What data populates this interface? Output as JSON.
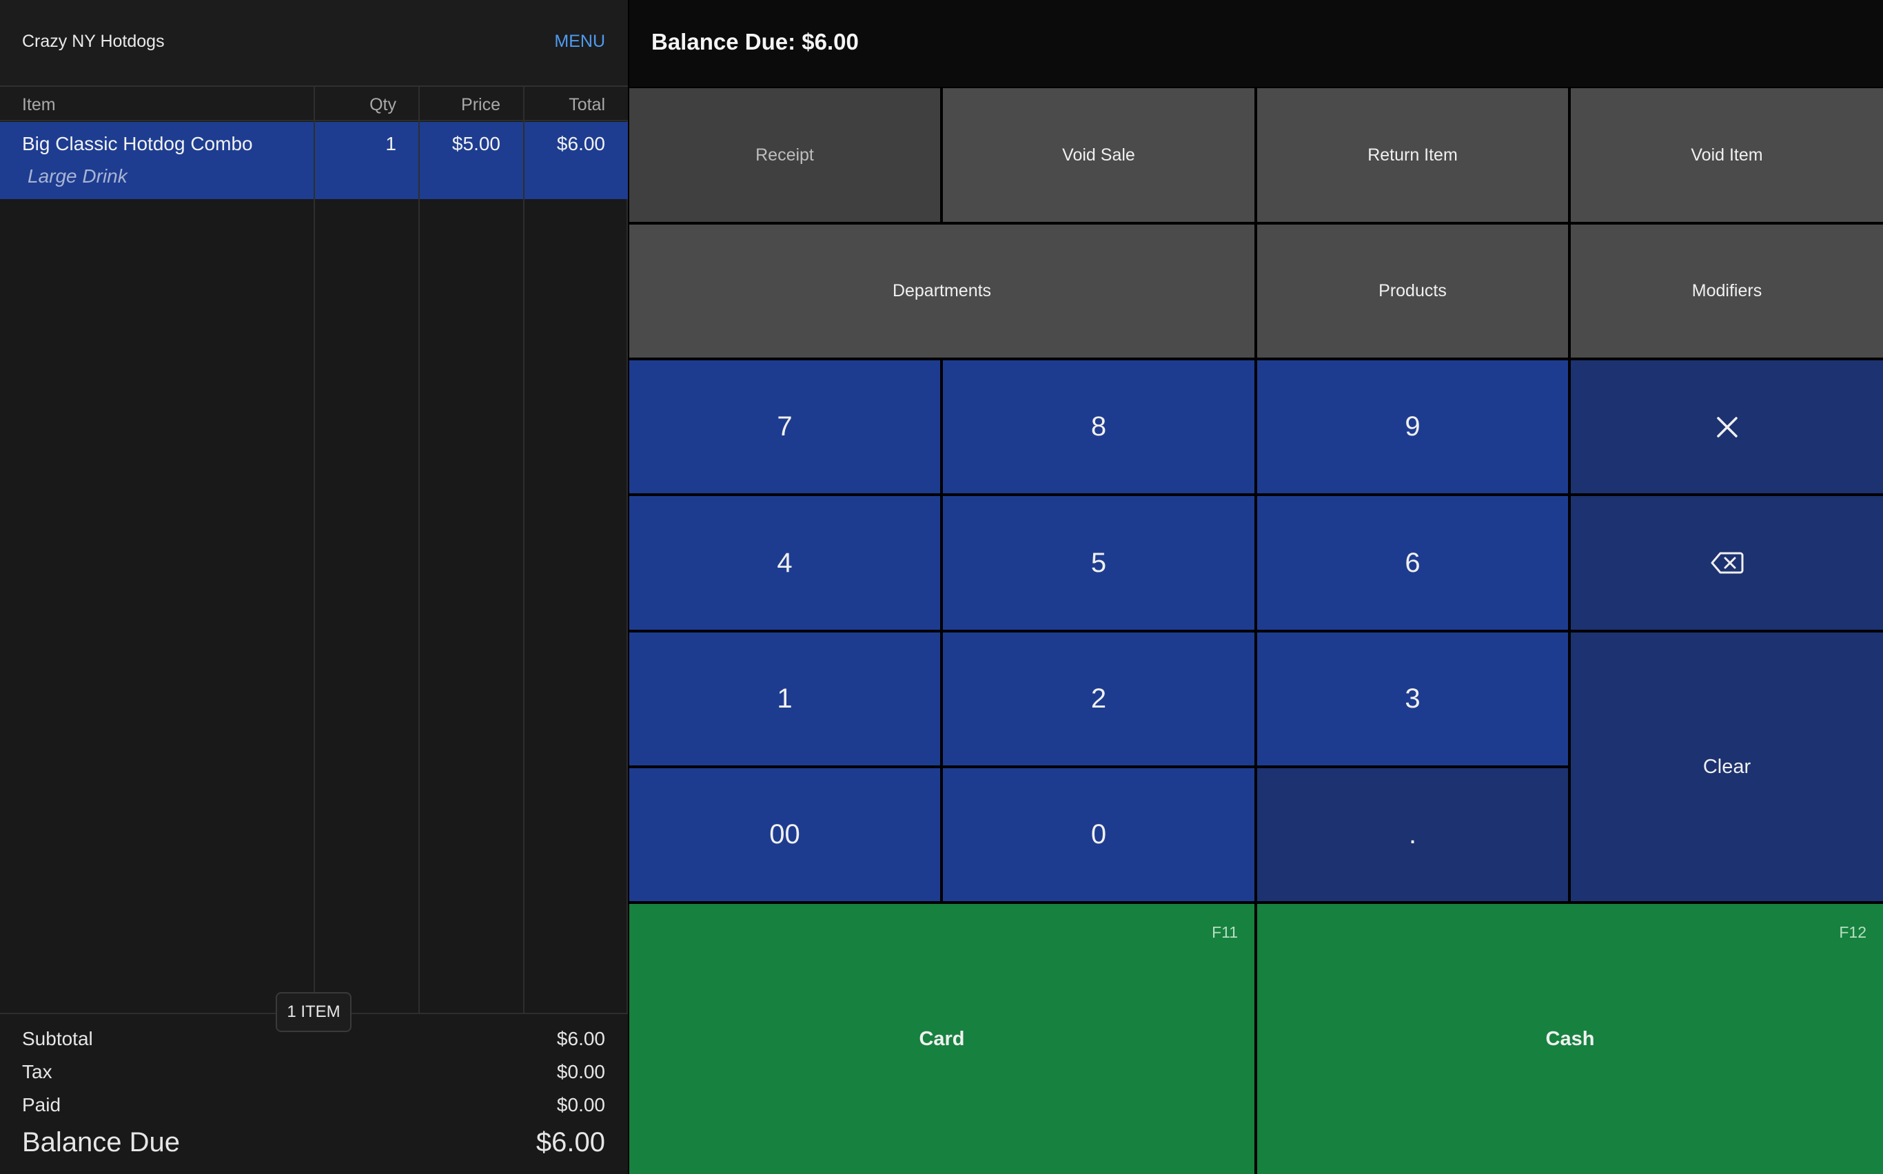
{
  "store": {
    "name": "Crazy NY Hotdogs",
    "menu_label": "MENU"
  },
  "columns": {
    "item": "Item",
    "qty": "Qty",
    "price": "Price",
    "total": "Total"
  },
  "order_lines": [
    {
      "item": "Big Classic Hotdog Combo",
      "modifier": "Large Drink",
      "qty": "1",
      "price": "$5.00",
      "total": "$6.00",
      "selected": true
    }
  ],
  "item_count_badge": "1 ITEM",
  "totals": {
    "subtotal_label": "Subtotal",
    "subtotal": "$6.00",
    "tax_label": "Tax",
    "tax": "$0.00",
    "paid_label": "Paid",
    "paid": "$0.00",
    "balance_label": "Balance Due",
    "balance": "$6.00"
  },
  "balance_header": "Balance Due: $6.00",
  "actions": {
    "receipt": "Receipt",
    "void_sale": "Void Sale",
    "return_item": "Return Item",
    "void_item": "Void Item",
    "departments": "Departments",
    "products": "Products",
    "modifiers": "Modifiers"
  },
  "keypad": {
    "k7": "7",
    "k8": "8",
    "k9": "9",
    "k4": "4",
    "k5": "5",
    "k6": "6",
    "k1": "1",
    "k2": "2",
    "k3": "3",
    "k00": "00",
    "k0": "0",
    "dot": ".",
    "multiply_icon": "close-x-icon",
    "backspace_icon": "backspace-icon",
    "clear": "Clear"
  },
  "payment": {
    "card_label": "Card",
    "card_key": "F11",
    "cash_label": "Cash",
    "cash_key": "F12"
  },
  "colors": {
    "accent_blue": "#1e3c8f",
    "selected_row": "#1e3d91",
    "pay_green": "#17813f",
    "menu_link": "#4f9bf0"
  }
}
